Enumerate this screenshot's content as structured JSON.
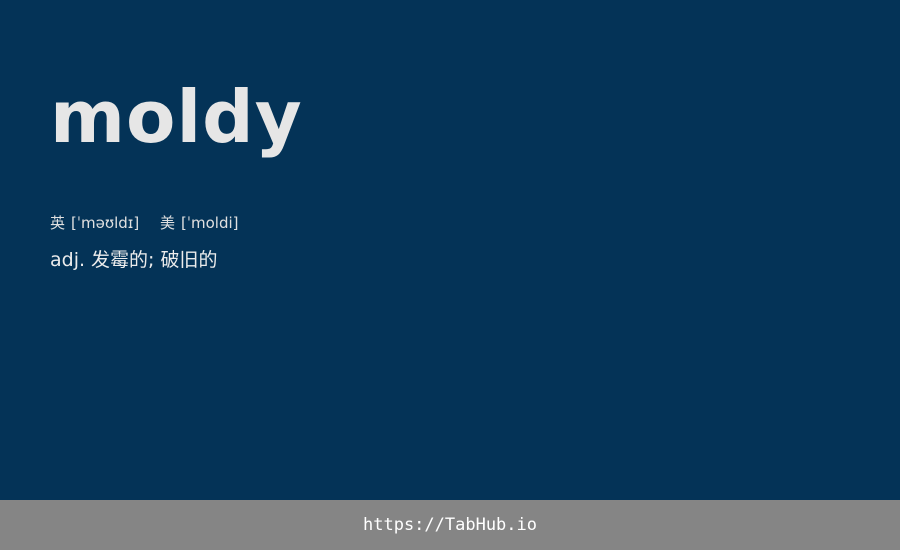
{
  "word": "moldy",
  "phonetics": {
    "uk_label": "英",
    "uk_ipa": "[ˈməʊldɪ]",
    "us_label": "美",
    "us_ipa": "[ˈmoldi]"
  },
  "definition": "adj. 发霉的; 破旧的",
  "footer": {
    "url": "https://TabHub.io"
  },
  "colors": {
    "background": "#043357",
    "footer_background": "#858585",
    "word_text": "#e6e6e6"
  }
}
